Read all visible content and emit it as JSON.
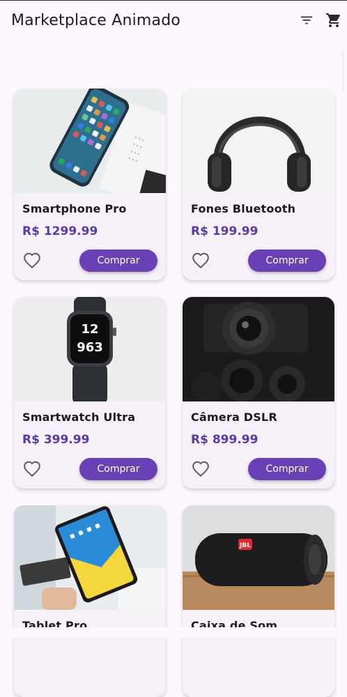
{
  "appbar": {
    "title": "Marketplace Animado",
    "filter_icon": "filter-list-icon",
    "cart_icon": "shopping-cart-icon"
  },
  "colors": {
    "accent": "#6a40b5",
    "price": "#5a3aa8",
    "card_bg": "#f6f1f8",
    "page_bg": "#fcf8fd"
  },
  "products": [
    {
      "name": "Smartphone Pro",
      "price": "R$ 1299.99",
      "buy_label": "Comprar",
      "image_icon": "smartphone-image"
    },
    {
      "name": "Fones Bluetooth",
      "price": "R$ 199.99",
      "buy_label": "Comprar",
      "image_icon": "headphones-image"
    },
    {
      "name": "Smartwatch Ultra",
      "price": "R$ 399.99",
      "buy_label": "Comprar",
      "image_icon": "smartwatch-image"
    },
    {
      "name": "Câmera DSLR",
      "price": "R$ 899.99",
      "buy_label": "Comprar",
      "image_icon": "camera-image"
    },
    {
      "name": "Tablet Pro",
      "price": "",
      "buy_label": "",
      "image_icon": "tablet-image"
    },
    {
      "name": "Caixa de Som",
      "price": "",
      "buy_label": "",
      "image_icon": "speaker-image"
    }
  ]
}
